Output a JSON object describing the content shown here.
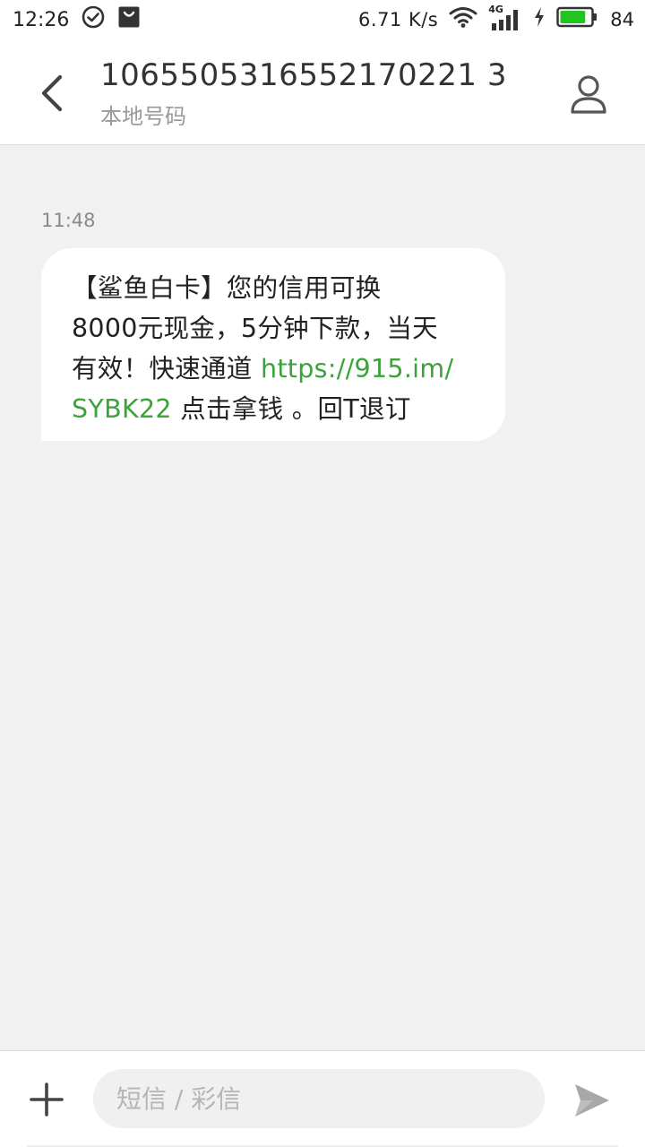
{
  "status_bar": {
    "time": "12:26",
    "net_speed": "6.71 K/s",
    "network_type": "4G",
    "battery_level": "84",
    "battery_fraction": 0.84,
    "icons": [
      "check-circle-icon",
      "shopping-bag-icon",
      "wifi-icon",
      "cell-signal-icon",
      "charging-icon",
      "battery-icon"
    ]
  },
  "header": {
    "contact_number": "1065505316552170221 3",
    "contact_subtitle": "本地号码",
    "icons": [
      "back-arrow-icon",
      "person-icon"
    ]
  },
  "conversation": {
    "messages": [
      {
        "time": "11:48",
        "line1": "【鲨鱼白卡】您的信用可换",
        "line2": "8000元现金，5分钟下款，当天",
        "line3_text": "有效！快速通道 ",
        "line3_link": "https://915.im/",
        "line4_link": "SYBK22",
        "line4_text": " 点击拿钱 。回T退订"
      }
    ]
  },
  "compose": {
    "placeholder": "短信 / 彩信",
    "value": "",
    "icons": [
      "plus-icon",
      "send-icon"
    ]
  },
  "colors": {
    "link": "#3aa33a",
    "battery": "#22c422",
    "background": "#f1f1f1"
  }
}
